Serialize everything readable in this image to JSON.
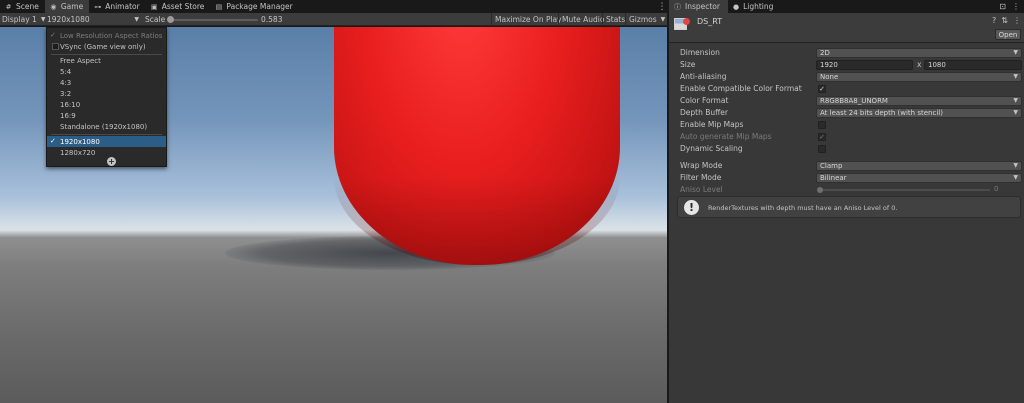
{
  "scene_tabs": [
    {
      "label": "Scene",
      "icon": "grid-icon",
      "active": false
    },
    {
      "label": "Game",
      "icon": "game-controller-icon",
      "active": true
    },
    {
      "label": "Animator",
      "icon": "animator-icon",
      "active": false
    },
    {
      "label": "Asset Store",
      "icon": "shopping-bag-icon",
      "active": false
    },
    {
      "label": "Package Manager",
      "icon": "package-icon",
      "active": false
    }
  ],
  "game_toolbar": {
    "display": "Display 1",
    "resolution": "1920x1080",
    "scale_label": "Scale",
    "scale_value": "0.583",
    "scale_fraction": 0.0,
    "maximize_on_play": "Maximize On Play",
    "mute_audio": "Mute Audio",
    "stats": "Stats",
    "gizmos": "Gizmos"
  },
  "resolution_dropdown": {
    "low_res": "Low Resolution Aspect Ratios",
    "vsync": "VSync (Game view only)",
    "aspects": [
      "Free Aspect",
      "5:4",
      "4:3",
      "3:2",
      "16:10",
      "16:9",
      "Standalone (1920x1080)"
    ],
    "custom": [
      "1920x1080",
      "1280x720"
    ],
    "selected": "1920x1080"
  },
  "inspector_tabs": [
    {
      "label": "Inspector",
      "icon": "info-icon",
      "active": true
    },
    {
      "label": "Lighting",
      "icon": "lightbulb-icon",
      "active": false
    }
  ],
  "asset": {
    "name": "DS_RT",
    "open_label": "Open"
  },
  "properties": {
    "dimension": {
      "label": "Dimension",
      "value": "2D"
    },
    "size": {
      "label": "Size",
      "width": "1920",
      "x": "x",
      "height": "1080"
    },
    "anti_aliasing": {
      "label": "Anti-aliasing",
      "value": "None"
    },
    "compatible_color": {
      "label": "Enable Compatible Color Format",
      "checked": "✓"
    },
    "color_format": {
      "label": "Color Format",
      "value": "R8G8B8A8_UNORM"
    },
    "depth_buffer": {
      "label": "Depth Buffer",
      "value": "At least 24 bits depth (with stencil)"
    },
    "mip_maps": {
      "label": "Enable Mip Maps",
      "checked": ""
    },
    "auto_mip": {
      "label": "Auto generate Mip Maps",
      "checked": "✓"
    },
    "dynamic_scaling": {
      "label": "Dynamic Scaling",
      "checked": ""
    },
    "wrap_mode": {
      "label": "Wrap Mode",
      "value": "Clamp"
    },
    "filter_mode": {
      "label": "Filter Mode",
      "value": "Bilinear"
    },
    "aniso_level": {
      "label": "Aniso Level",
      "value": "0"
    }
  },
  "help_message": "RenderTextures with depth must have an Aniso Level of 0.",
  "colors": {
    "editor_bg": "#383838",
    "toolbar_bg": "#3c3c3c",
    "selection": "#2c5d87",
    "capsule_red": "#e81e1e"
  }
}
